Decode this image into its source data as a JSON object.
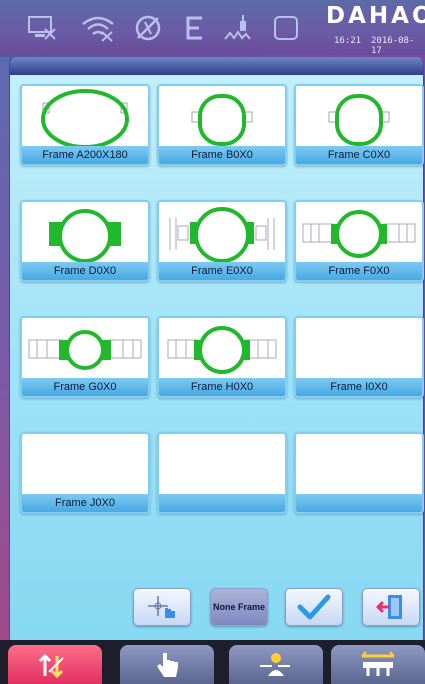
{
  "brand": {
    "name": "DAHAO",
    "time": "16:21",
    "date": "2016-08-17"
  },
  "status_icons": [
    "computer-icon",
    "wifi-off-icon",
    "no-needle-icon",
    "e-mode-icon",
    "pen-signal-icon",
    "blank-square-icon"
  ],
  "frames": [
    {
      "label": "Frame A200X180",
      "shape": "oval-large"
    },
    {
      "label": "Frame B0X0",
      "shape": "round-small-arms"
    },
    {
      "label": "Frame C0X0",
      "shape": "round-small-arms"
    },
    {
      "label": "Frame D0X0",
      "shape": "round-green-tabs"
    },
    {
      "label": "Frame E0X0",
      "shape": "round-green-brackets"
    },
    {
      "label": "Frame F0X0",
      "shape": "round-green-rails"
    },
    {
      "label": "Frame G0X0",
      "shape": "round-green-rails"
    },
    {
      "label": "Frame H0X0",
      "shape": "round-green-rails"
    },
    {
      "label": "Frame I0X0",
      "shape": "empty"
    },
    {
      "label": "Frame J0X0",
      "shape": "empty"
    },
    {
      "label": "",
      "shape": "empty"
    },
    {
      "label": "",
      "shape": "empty"
    }
  ],
  "toolbar": {
    "none_frame_label": "None Frame"
  },
  "colors": {
    "frame_green": "#22b82c",
    "active_tab": "#ef4a70",
    "label_blue": "#5cb8ea"
  }
}
